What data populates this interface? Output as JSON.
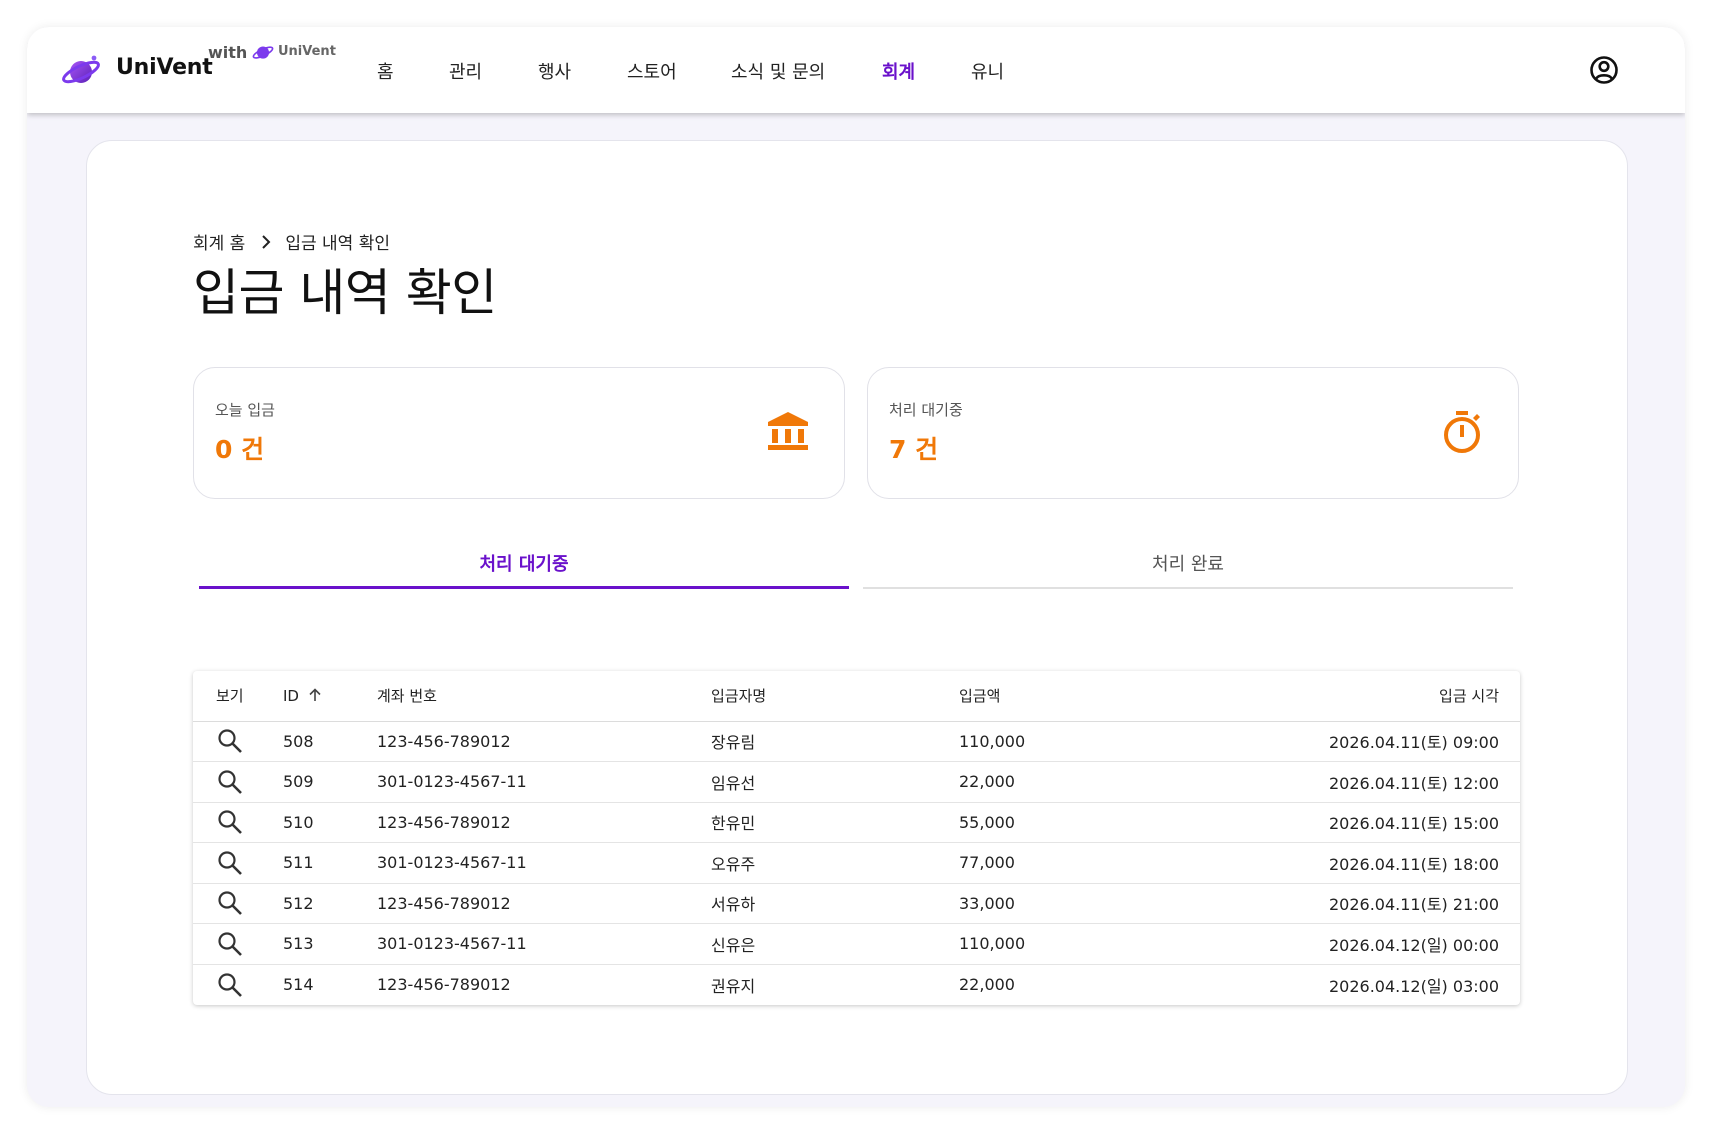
{
  "header": {
    "brand": "UniVent",
    "with_label": "with",
    "with_brand": "UniVent",
    "nav": [
      {
        "label": "홈",
        "active": false
      },
      {
        "label": "관리",
        "active": false
      },
      {
        "label": "행사",
        "active": false
      },
      {
        "label": "스토어",
        "active": false
      },
      {
        "label": "소식 및 문의",
        "active": false
      },
      {
        "label": "회계",
        "active": true
      },
      {
        "label": "유니",
        "active": false
      }
    ],
    "account_icon": "account-circle-icon"
  },
  "breadcrumb": {
    "parent": "회계 홈",
    "current": "입금 내역 확인"
  },
  "page_title": "입금 내역 확인",
  "stats": [
    {
      "label": "오늘 입금",
      "value": "0 건",
      "icon": "bank-icon"
    },
    {
      "label": "처리 대기중",
      "value": "7 건",
      "icon": "timer-icon"
    }
  ],
  "tabs": [
    {
      "label": "처리 대기중",
      "active": true
    },
    {
      "label": "처리 완료",
      "active": false
    }
  ],
  "table": {
    "columns": [
      "보기",
      "ID",
      "계좌 번호",
      "입금자명",
      "입금액",
      "입금 시각"
    ],
    "sort": {
      "column": "ID",
      "direction": "ascending"
    },
    "rows": [
      {
        "id": "508",
        "account": "123-456-789012",
        "name": "장유림",
        "amount": "110,000",
        "time": "2026.04.11(토) 09:00"
      },
      {
        "id": "509",
        "account": "301-0123-4567-11",
        "name": "임유선",
        "amount": "22,000",
        "time": "2026.04.11(토) 12:00"
      },
      {
        "id": "510",
        "account": "123-456-789012",
        "name": "한유민",
        "amount": "55,000",
        "time": "2026.04.11(토) 15:00"
      },
      {
        "id": "511",
        "account": "301-0123-4567-11",
        "name": "오유주",
        "amount": "77,000",
        "time": "2026.04.11(토) 18:00"
      },
      {
        "id": "512",
        "account": "123-456-789012",
        "name": "서유하",
        "amount": "33,000",
        "time": "2026.04.11(토) 21:00"
      },
      {
        "id": "513",
        "account": "301-0123-4567-11",
        "name": "신유은",
        "amount": "110,000",
        "time": "2026.04.12(일) 00:00"
      },
      {
        "id": "514",
        "account": "123-456-789012",
        "name": "권유지",
        "amount": "22,000",
        "time": "2026.04.12(일) 03:00"
      }
    ]
  },
  "colors": {
    "accent": "#6a11cb",
    "stat_value": "#f07808",
    "background": "#f5f4fb"
  }
}
